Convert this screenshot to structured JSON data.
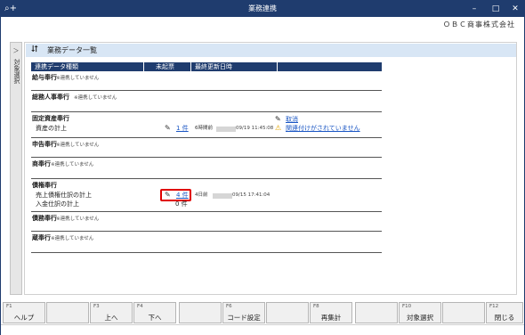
{
  "window": {
    "title": "業務連携",
    "app_icon": "app-plus-icon",
    "controls": [
      "–",
      "□",
      "✕"
    ]
  },
  "company": "ＯＢＣ商事株式会社",
  "side_tab": {
    "arrow": "＞",
    "label": "対象選択"
  },
  "section": {
    "title": "業務データ一覧",
    "icon": "refresh-icon"
  },
  "table": {
    "headers": {
      "type": "連携データ種類",
      "unposted": "未起票",
      "updated": "最終更新日時"
    },
    "groups": [
      {
        "name": "給与奉行",
        "note": "※連携していません"
      },
      {
        "name": "総務人事奉行",
        "note": "※連携していません"
      },
      {
        "name": "固定資産奉行",
        "rows": [
          {
            "label": "資産の計上",
            "count": "1 件",
            "ago": "6時間前",
            "stamp": "09/19 11:45:08",
            "action": "取消",
            "warning": "関連付けがされていません"
          }
        ]
      },
      {
        "name": "申告奉行",
        "note": "※連携していません"
      },
      {
        "name": "商奉行",
        "note": "※連携していません"
      },
      {
        "name": "債権奉行",
        "rows": [
          {
            "label": "売上債権仕訳の計上",
            "count": "4 件",
            "ago": "4日前",
            "stamp": "09/15 17:41:04"
          },
          {
            "label": "入金仕訳の計上",
            "count": "0 件"
          }
        ]
      },
      {
        "name": "債務奉行",
        "note": "※連携していません"
      },
      {
        "name": "蔵奉行",
        "note": "※連携していません"
      }
    ]
  },
  "fkeys": [
    {
      "key": "F1",
      "label": "ヘルプ"
    },
    {
      "key": "",
      "label": ""
    },
    {
      "key": "F3",
      "label": "上へ"
    },
    {
      "key": "F4",
      "label": "下へ"
    },
    {
      "key": "",
      "label": ""
    },
    {
      "key": "F6",
      "label": "コード設定"
    },
    {
      "key": "",
      "label": ""
    },
    {
      "key": "F8",
      "label": "再集計"
    },
    {
      "key": "",
      "label": ""
    },
    {
      "key": "F10",
      "label": "対象選択"
    },
    {
      "key": "",
      "label": ""
    },
    {
      "key": "F12",
      "label": "閉じる"
    }
  ]
}
